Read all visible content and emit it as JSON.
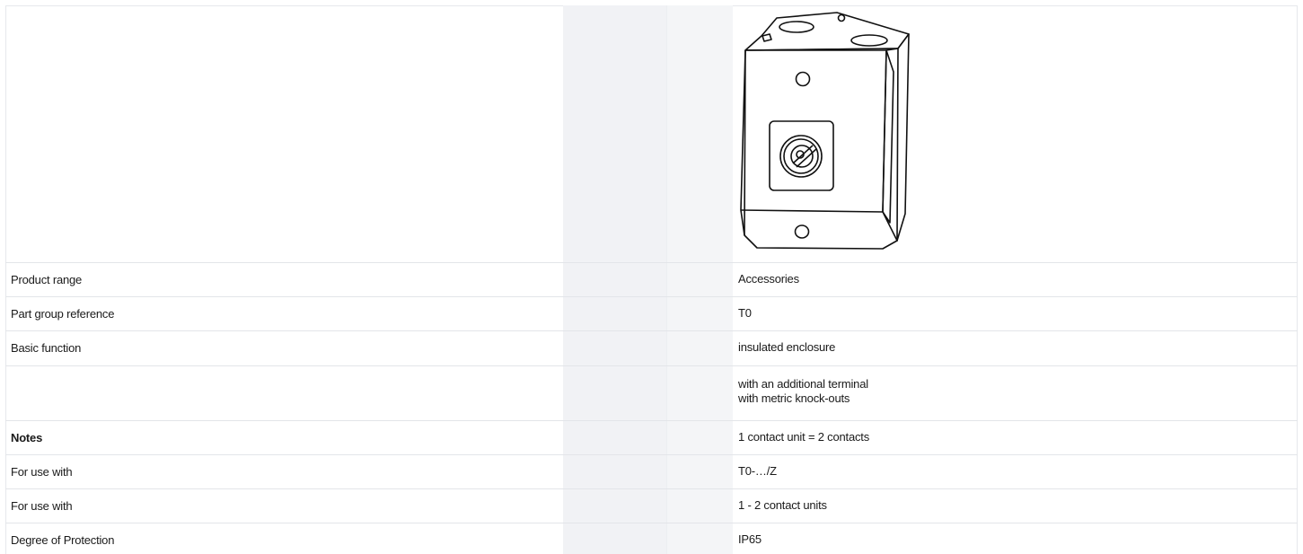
{
  "rows": [
    {
      "label": "Product range",
      "value_lines": [
        "Accessories"
      ],
      "bold": false
    },
    {
      "label": "Part group reference",
      "value_lines": [
        "T0"
      ],
      "bold": false
    },
    {
      "label": "Basic function",
      "value_lines": [
        "insulated enclosure"
      ],
      "bold": false
    },
    {
      "label": "",
      "value_lines": [
        "with an additional terminal",
        "with metric knock-outs"
      ],
      "bold": false
    },
    {
      "label": "Notes",
      "value_lines": [
        "1 contact unit = 2 contacts"
      ],
      "bold": true
    },
    {
      "label": "For use with",
      "value_lines": [
        "T0-…/Z"
      ],
      "bold": false
    },
    {
      "label": "For use with",
      "value_lines": [
        "1 - 2 contact units"
      ],
      "bold": false
    },
    {
      "label": "Degree of Protection",
      "value_lines": [
        "IP65"
      ],
      "bold": false
    }
  ],
  "product_image": {
    "icon": "insulated-enclosure-icon",
    "stroke_color": "#111111"
  }
}
